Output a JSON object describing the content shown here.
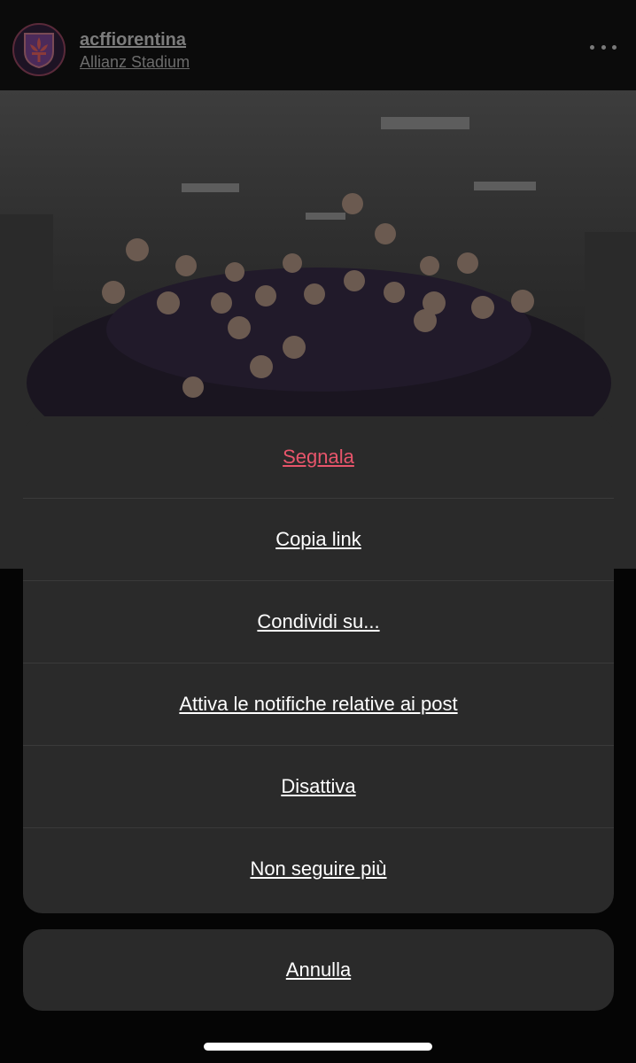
{
  "post": {
    "username": "acffiorentina",
    "location": "Allianz Stadium",
    "avatar_icon": "fiorentina-lily-crest-icon",
    "more_icon": "more-horizontal-icon"
  },
  "action_sheet": {
    "items": [
      {
        "label": "Segnala",
        "color": "#e8556b"
      },
      {
        "label": "Copia link"
      },
      {
        "label": "Condividi su..."
      },
      {
        "label": "Attiva le notifiche relative ai post"
      },
      {
        "label": "Disattiva"
      },
      {
        "label": "Non seguire più"
      }
    ],
    "cancel_label": "Annulla"
  },
  "colors": {
    "sheet_bg": "#2a2a2a",
    "danger": "#e8556b",
    "text": "#ffffff"
  }
}
